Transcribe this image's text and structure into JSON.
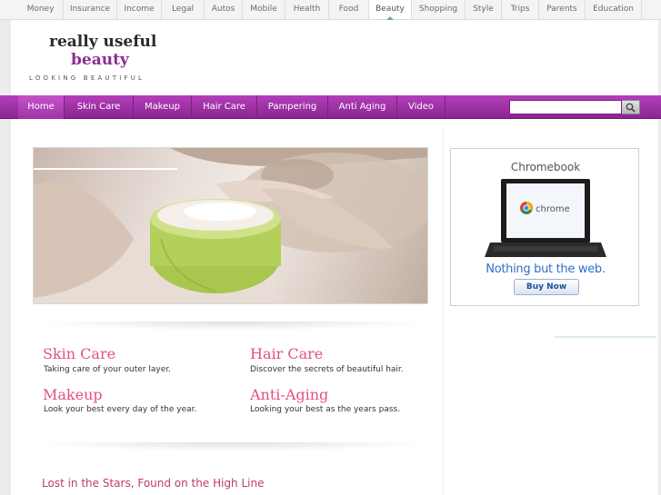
{
  "topnav": {
    "items": [
      "Money",
      "Insurance",
      "Income",
      "Legal",
      "Autos",
      "Mobile",
      "Health",
      "Food",
      "Beauty",
      "Shopping",
      "Style",
      "Trips",
      "Parents",
      "Education"
    ],
    "active": "Beauty"
  },
  "logo": {
    "line1": "really useful",
    "line2": "beauty",
    "tagline": "LOOKING BEAUTIFUL"
  },
  "mainnav": {
    "items": [
      "Home",
      "Skin Care",
      "Makeup",
      "Hair Care",
      "Pampering",
      "Anti Aging",
      "Video"
    ],
    "active": "Home"
  },
  "search": {
    "placeholder": "",
    "value": ""
  },
  "ad": {
    "title": "Chromebook",
    "screen_label": "chrome",
    "tagline": "Nothing but the web.",
    "button": "Buy Now"
  },
  "sections": [
    {
      "title": "Skin Care",
      "desc": "Taking care of your outer layer."
    },
    {
      "title": "Hair Care",
      "desc": "Discover the secrets of beautiful hair."
    },
    {
      "title": "Makeup",
      "desc": "Look your best every day of the year."
    },
    {
      "title": "Anti-Aging",
      "desc": "Looking your best as the years pass."
    }
  ],
  "article": {
    "title": "Lost in the Stars, Found on the High Line"
  },
  "colors": {
    "brand_purple": "#9b2fa1",
    "section_pink": "#e4527a",
    "ad_blue": "#2f6fc8"
  }
}
